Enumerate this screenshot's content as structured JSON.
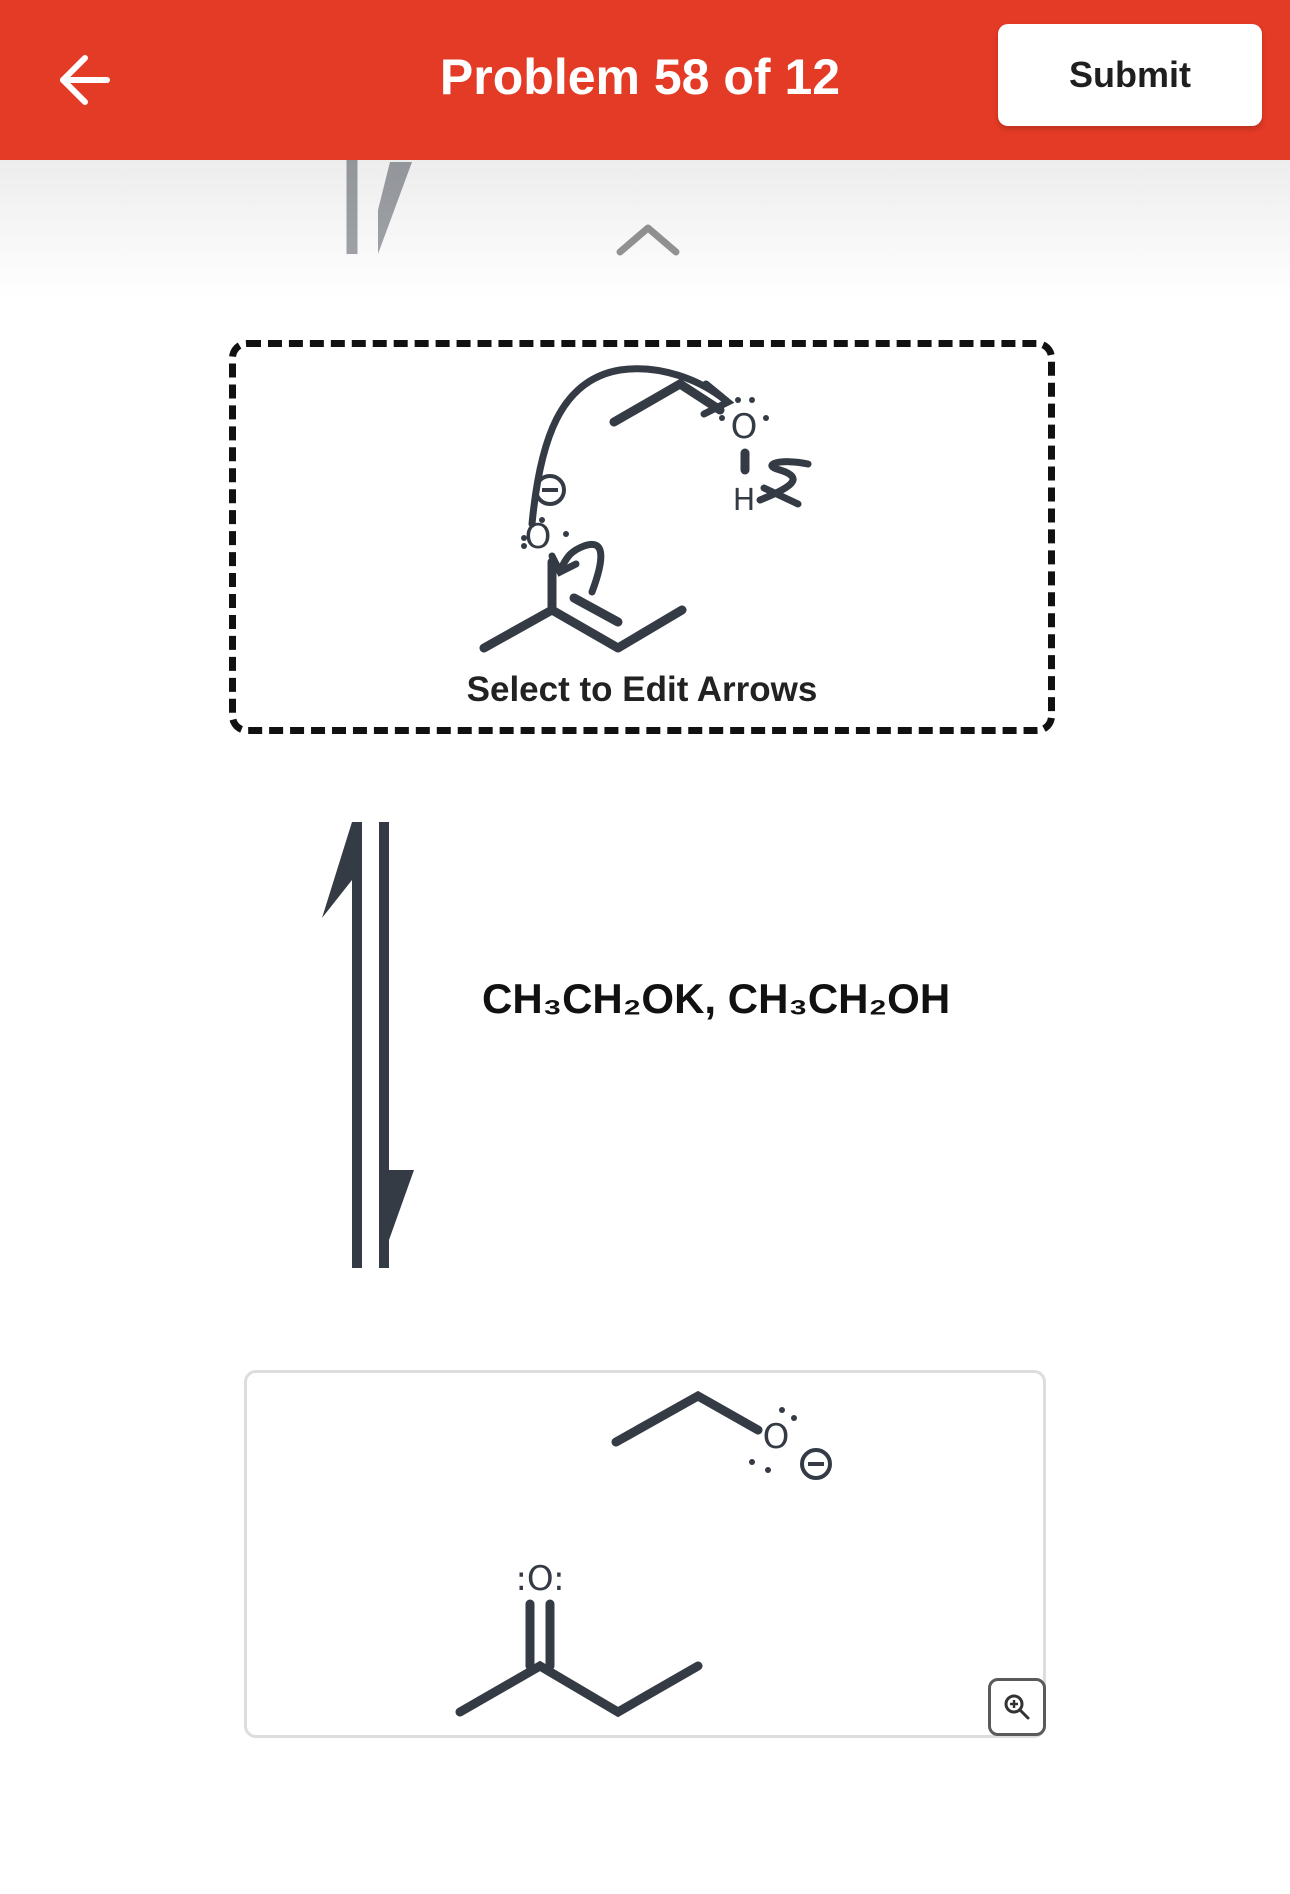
{
  "header": {
    "title": "Problem 58 of 12",
    "submit_label": "Submit",
    "back_icon": "arrow-left-icon",
    "background_color": "#e43b26"
  },
  "mechanism": {
    "edit_label": "Select to Edit Arrows",
    "atom_labels": {
      "oxygen": "O",
      "hydrogen": "H",
      "negative_charge": "⊖"
    }
  },
  "reaction": {
    "reagents": "CH₃CH₂OK, CH₃CH₂OH",
    "arrow_type": "equilibrium"
  },
  "product": {
    "carbonyl_oxygen_label": ":O:",
    "ethoxide_oxygen_label": "O",
    "charge_symbol": "⊖",
    "zoom_icon": "zoom-in-icon"
  },
  "colors": {
    "bond": "#353b45",
    "ink": "#111111",
    "panel_border": "#dddddd"
  }
}
